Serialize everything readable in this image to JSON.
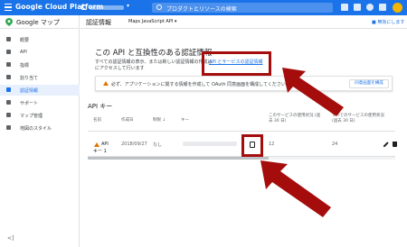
{
  "topbar": {
    "brand": "Google Cloud Platform",
    "search_placeholder": "プロダクトとリソースの検索"
  },
  "sidebar": {
    "title": "Google マップ",
    "items": [
      {
        "label": "概要"
      },
      {
        "label": "API"
      },
      {
        "label": "指標"
      },
      {
        "label": "割り当て"
      },
      {
        "label": "認証情報"
      },
      {
        "label": "サポート"
      },
      {
        "label": "マップ管理"
      },
      {
        "label": "地図のスタイル"
      }
    ],
    "collapse": "<]"
  },
  "header": {
    "page_title": "認証情報",
    "project_selector": "Maps JavaScript API ▾",
    "notification_link": "■ 無効にします"
  },
  "main": {
    "heading": "この API と互換性のある認証情報",
    "desc_line1": "すべての認証情報の表示、または新しい認証情報の作成は",
    "desc_line2": "にアクセスして行います",
    "link": "API とサービスの認証情報",
    "warning_text": "必ず、アプリケーションに関する情報を作成して OAuth 同意画面を構成してください。",
    "warning_button": "同意画面を構成",
    "api_keys_title": "API キー",
    "columns": [
      "名前",
      "作成日",
      "制限 ↓",
      "キー",
      "このサービスの使用状況 (過去 30 日)",
      "すべてのサービスの使用状況 (過去 30 日)"
    ],
    "rows": [
      {
        "name_line1": "API",
        "name_line2": "キー 1",
        "created": "2018/09/27",
        "restriction": "なし",
        "service_usage": "12",
        "all_usage": "24"
      }
    ]
  },
  "colors": {
    "topbar": "#1a73e8",
    "highlight": "#a50d0d",
    "warning": "#e37400"
  }
}
